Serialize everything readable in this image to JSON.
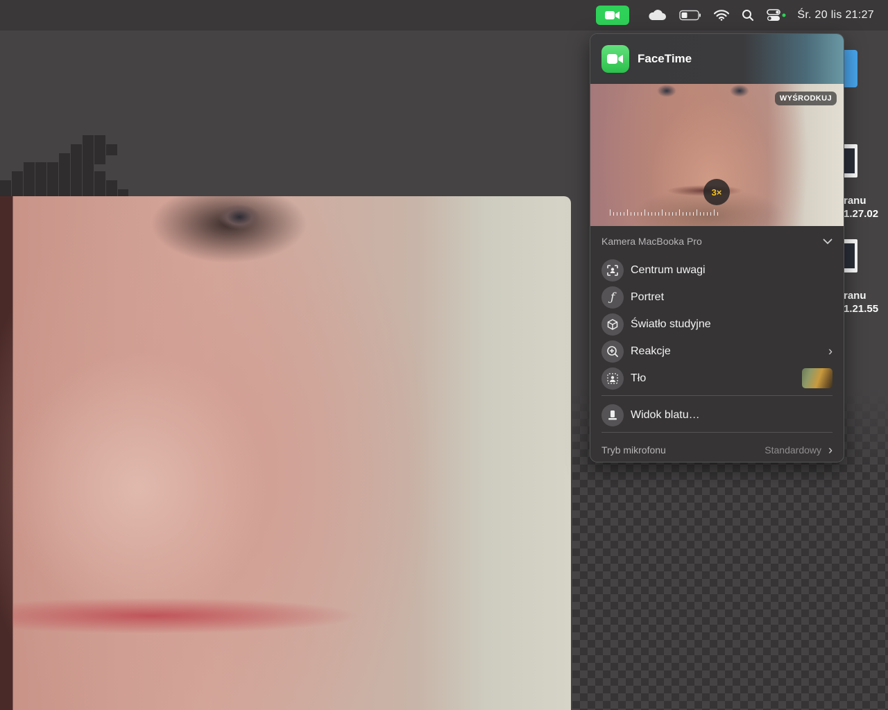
{
  "menubar": {
    "clock": "Śr. 20 lis  21:27",
    "icons": [
      "facetime-indicator-icon",
      "icloud-icon",
      "battery-icon",
      "wifi-icon",
      "search-icon",
      "control-center-icon"
    ]
  },
  "desktop": {
    "files": [
      {
        "label_line1": "ranu",
        "label_line2": "1.27.02"
      },
      {
        "label_line1": "ranu",
        "label_line2": "1.21.55"
      }
    ]
  },
  "panel": {
    "app_title": "FaceTime",
    "center_button": "WYŚRODKUJ",
    "zoom_level": "3×",
    "camera_label": "Kamera MacBooka Pro",
    "items": [
      {
        "label": "Centrum uwagi",
        "icon": "center-stage-icon"
      },
      {
        "label": "Portret",
        "icon": "portrait-icon"
      },
      {
        "label": "Światło studyjne",
        "icon": "studio-light-icon"
      },
      {
        "label": "Reakcje",
        "icon": "reactions-icon",
        "has_submenu": true
      },
      {
        "label": "Tło",
        "icon": "background-icon",
        "has_thumbnail": true
      }
    ],
    "desk_view": {
      "label": "Widok blatu…",
      "icon": "desk-view-icon"
    },
    "mic_mode": {
      "label": "Tryb mikrofonu",
      "value": "Standardowy"
    }
  },
  "colors": {
    "facetime_green": "#2fd158",
    "panel_bg": "#363435",
    "zoom_accent": "#f5c21c"
  }
}
